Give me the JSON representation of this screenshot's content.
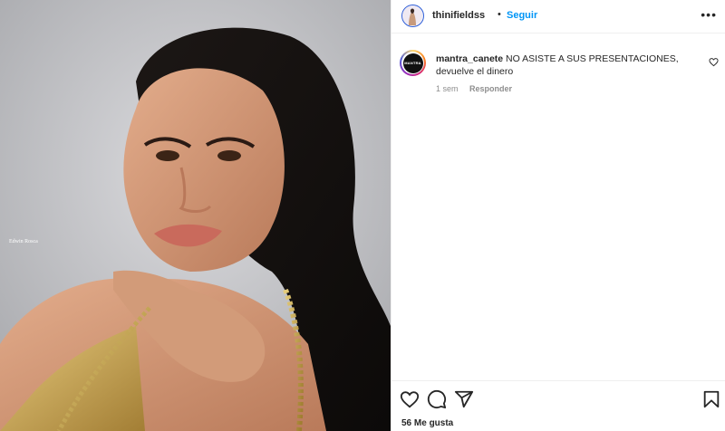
{
  "post": {
    "author": "thinifieldss",
    "separator": "•",
    "follow_label": "Seguir",
    "more_label": "•••",
    "photo_watermark": "Edwin Rosca",
    "likes_text": "56 Me gusta"
  },
  "comment": {
    "username": "mantra_canete",
    "text": " NO ASISTE A SUS PRESENTACIONES, devuelve el dinero",
    "avatar_text": "MANTRA",
    "time": "1 sem",
    "reply_label": "Responder"
  },
  "icons": {
    "like": "heart-icon",
    "comment": "comment-icon",
    "share": "send-icon",
    "save": "bookmark-icon",
    "comment_like": "small-heart-icon",
    "more": "more-options-icon"
  },
  "colors": {
    "accent": "#0095f6",
    "text": "#262626",
    "muted": "#8e8e8e"
  }
}
